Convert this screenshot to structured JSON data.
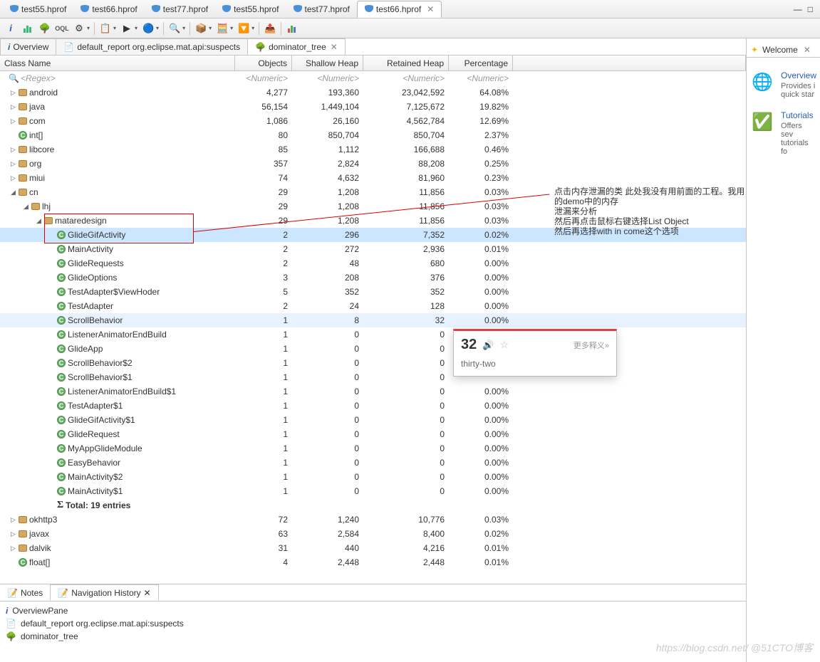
{
  "topTabs": [
    {
      "label": "test55.hprof",
      "active": false
    },
    {
      "label": "test66.hprof",
      "active": false
    },
    {
      "label": "test77.hprof",
      "active": false
    },
    {
      "label": "test55.hprof",
      "active": false
    },
    {
      "label": "test77.hprof",
      "active": false
    },
    {
      "label": "test66.hprof",
      "active": true
    }
  ],
  "subTabs": [
    {
      "icon": "i",
      "label": "Overview"
    },
    {
      "icon": "rep",
      "label": "default_report  org.eclipse.mat.api:suspects"
    },
    {
      "icon": "tree",
      "label": "dominator_tree",
      "active": true
    }
  ],
  "columns": [
    "Class Name",
    "Objects",
    "Shallow Heap",
    "Retained Heap",
    "Percentage"
  ],
  "regexRow": {
    "name": "<Regex>",
    "n1": "<Numeric>",
    "n2": "<Numeric>",
    "n3": "<Numeric>",
    "n4": "<Numeric>"
  },
  "rows": [
    {
      "d": 0,
      "t": "pkg",
      "e": "c",
      "name": "android",
      "o": "4,277",
      "s": "193,360",
      "r": "23,042,592",
      "p": "64.08%"
    },
    {
      "d": 0,
      "t": "pkg",
      "e": "c",
      "name": "java",
      "o": "56,154",
      "s": "1,449,104",
      "r": "7,125,672",
      "p": "19.82%"
    },
    {
      "d": 0,
      "t": "pkg",
      "e": "c",
      "name": "com",
      "o": "1,086",
      "s": "26,160",
      "r": "4,562,784",
      "p": "12.69%"
    },
    {
      "d": 0,
      "t": "cls",
      "e": "",
      "name": "int[]",
      "o": "80",
      "s": "850,704",
      "r": "850,704",
      "p": "2.37%"
    },
    {
      "d": 0,
      "t": "pkg",
      "e": "c",
      "name": "libcore",
      "o": "85",
      "s": "1,112",
      "r": "166,688",
      "p": "0.46%"
    },
    {
      "d": 0,
      "t": "pkg",
      "e": "c",
      "name": "org",
      "o": "357",
      "s": "2,824",
      "r": "88,208",
      "p": "0.25%"
    },
    {
      "d": 0,
      "t": "pkg",
      "e": "c",
      "name": "miui",
      "o": "74",
      "s": "4,632",
      "r": "81,960",
      "p": "0.23%"
    },
    {
      "d": 0,
      "t": "pkg",
      "e": "o",
      "name": "cn",
      "o": "29",
      "s": "1,208",
      "r": "11,856",
      "p": "0.03%"
    },
    {
      "d": 1,
      "t": "pkg",
      "e": "o",
      "name": "lhj",
      "o": "29",
      "s": "1,208",
      "r": "11,856",
      "p": "0.03%"
    },
    {
      "d": 2,
      "t": "pkg",
      "e": "o",
      "name": "mataredesign",
      "o": "29",
      "s": "1,208",
      "r": "11,856",
      "p": "0.03%",
      "boxed": true
    },
    {
      "d": 3,
      "t": "cls",
      "e": "",
      "name": "GlideGifActivity",
      "o": "2",
      "s": "296",
      "r": "7,352",
      "p": "0.02%",
      "sel": true,
      "boxed": true
    },
    {
      "d": 3,
      "t": "cls",
      "e": "",
      "name": "MainActivity",
      "o": "2",
      "s": "272",
      "r": "2,936",
      "p": "0.01%"
    },
    {
      "d": 3,
      "t": "cls",
      "e": "",
      "name": "GlideRequests",
      "o": "2",
      "s": "48",
      "r": "680",
      "p": "0.00%"
    },
    {
      "d": 3,
      "t": "cls",
      "e": "",
      "name": "GlideOptions",
      "o": "3",
      "s": "208",
      "r": "376",
      "p": "0.00%"
    },
    {
      "d": 3,
      "t": "cls",
      "e": "",
      "name": "TestAdapter$ViewHoder",
      "o": "5",
      "s": "352",
      "r": "352",
      "p": "0.00%"
    },
    {
      "d": 3,
      "t": "cls",
      "e": "",
      "name": "TestAdapter",
      "o": "2",
      "s": "24",
      "r": "128",
      "p": "0.00%"
    },
    {
      "d": 3,
      "t": "cls",
      "e": "",
      "name": "ScrollBehavior",
      "o": "1",
      "s": "8",
      "r": "32",
      "p": "0.00%",
      "hl": true
    },
    {
      "d": 3,
      "t": "cls",
      "e": "",
      "name": "ListenerAnimatorEndBuild",
      "o": "1",
      "s": "0",
      "r": "0",
      "p": ""
    },
    {
      "d": 3,
      "t": "cls",
      "e": "",
      "name": "GlideApp",
      "o": "1",
      "s": "0",
      "r": "0",
      "p": ""
    },
    {
      "d": 3,
      "t": "cls",
      "e": "",
      "name": "ScrollBehavior$2",
      "o": "1",
      "s": "0",
      "r": "0",
      "p": ""
    },
    {
      "d": 3,
      "t": "cls",
      "e": "",
      "name": "ScrollBehavior$1",
      "o": "1",
      "s": "0",
      "r": "0",
      "p": ""
    },
    {
      "d": 3,
      "t": "cls",
      "e": "",
      "name": "ListenerAnimatorEndBuild$1",
      "o": "1",
      "s": "0",
      "r": "0",
      "p": "0.00%"
    },
    {
      "d": 3,
      "t": "cls",
      "e": "",
      "name": "TestAdapter$1",
      "o": "1",
      "s": "0",
      "r": "0",
      "p": "0.00%"
    },
    {
      "d": 3,
      "t": "cls",
      "e": "",
      "name": "GlideGifActivity$1",
      "o": "1",
      "s": "0",
      "r": "0",
      "p": "0.00%"
    },
    {
      "d": 3,
      "t": "cls",
      "e": "",
      "name": "GlideRequest",
      "o": "1",
      "s": "0",
      "r": "0",
      "p": "0.00%"
    },
    {
      "d": 3,
      "t": "cls",
      "e": "",
      "name": "MyAppGlideModule",
      "o": "1",
      "s": "0",
      "r": "0",
      "p": "0.00%"
    },
    {
      "d": 3,
      "t": "cls",
      "e": "",
      "name": "EasyBehavior",
      "o": "1",
      "s": "0",
      "r": "0",
      "p": "0.00%"
    },
    {
      "d": 3,
      "t": "cls",
      "e": "",
      "name": "MainActivity$2",
      "o": "1",
      "s": "0",
      "r": "0",
      "p": "0.00%"
    },
    {
      "d": 3,
      "t": "cls",
      "e": "",
      "name": "MainActivity$1",
      "o": "1",
      "s": "0",
      "r": "0",
      "p": "0.00%"
    },
    {
      "d": 3,
      "t": "tot",
      "e": "",
      "name": "Total: 19 entries",
      "o": "",
      "s": "",
      "r": "",
      "p": ""
    },
    {
      "d": 0,
      "t": "pkg",
      "e": "c",
      "name": "okhttp3",
      "o": "72",
      "s": "1,240",
      "r": "10,776",
      "p": "0.03%"
    },
    {
      "d": 0,
      "t": "pkg",
      "e": "c",
      "name": "javax",
      "o": "63",
      "s": "2,584",
      "r": "8,400",
      "p": "0.02%"
    },
    {
      "d": 0,
      "t": "pkg",
      "e": "c",
      "name": "dalvik",
      "o": "31",
      "s": "440",
      "r": "4,216",
      "p": "0.01%"
    },
    {
      "d": 0,
      "t": "cls",
      "e": "",
      "name": "float[]",
      "o": "4",
      "s": "2,448",
      "r": "2,448",
      "p": "0.01%"
    }
  ],
  "redText": {
    "l1": "点击内存泄漏的类 此处我没有用前面的工程。我用的demo中的内存",
    "l2": "泄漏来分析",
    "l3": "然后再点击鼠标右键选择List Object",
    "l4": "然后再选择with in come这个选项"
  },
  "popup": {
    "num": "32",
    "word": "thirty-two",
    "more": "更多释义»"
  },
  "bottomTabs": [
    {
      "label": "Notes"
    },
    {
      "label": "Navigation History",
      "active": true
    }
  ],
  "history": [
    {
      "ic": "i",
      "label": "OverviewPane"
    },
    {
      "ic": "rep",
      "label": "default_report  org.eclipse.mat.api:suspects"
    },
    {
      "ic": "tree",
      "label": "dominator_tree"
    }
  ],
  "welcomeTab": "Welcome",
  "rightItems": [
    {
      "emoji": "🌐",
      "title": "Overview",
      "desc": "Provides i\nquick star"
    },
    {
      "emoji": "✅",
      "title": "Tutorials",
      "desc": "Offers sev\ntutorials fo"
    }
  ],
  "watermark": "https://blog.csdn.net/  @51CTO博客"
}
